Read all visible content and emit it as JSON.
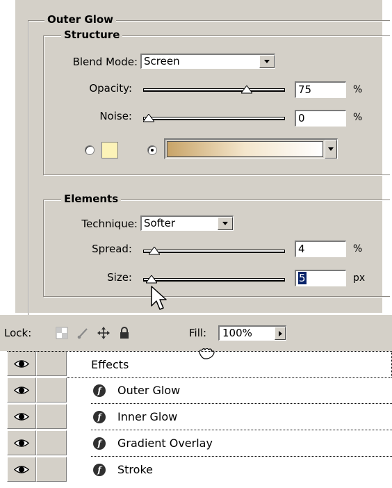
{
  "outer_glow": {
    "title": "Outer Glow",
    "structure": {
      "title": "Structure",
      "blend_mode_label": "Blend Mode:",
      "blend_mode_value": "Screen",
      "opacity_label": "Opacity:",
      "opacity_value": "75",
      "opacity_unit": "%",
      "opacity_level": 0.75,
      "noise_label": "Noise:",
      "noise_value": "0",
      "noise_unit": "%",
      "noise_level": 0.0,
      "solid_color": "#fcf3b8",
      "gradient_colors": [
        "#c8a468",
        "#f4e6cc",
        "#ffffff"
      ],
      "color_radio_selected": "gradient"
    },
    "elements": {
      "title": "Elements",
      "technique_label": "Technique:",
      "technique_value": "Softer",
      "spread_label": "Spread:",
      "spread_value": "4",
      "spread_unit": "%",
      "spread_level": 0.04,
      "size_label": "Size:",
      "size_value": "5",
      "size_unit": "px",
      "size_level": 0.02
    }
  },
  "layers_panel": {
    "lock_label": "Lock:",
    "lock_icons": [
      "lock-transparent-icon",
      "lock-brush-icon",
      "lock-move-icon",
      "lock-all-icon"
    ],
    "fill_label": "Fill:",
    "fill_value": "100%",
    "effects_label": "Effects",
    "effects": [
      {
        "name": "Outer Glow",
        "icon": "fx-icon",
        "visible": true
      },
      {
        "name": "Inner Glow",
        "icon": "fx-icon",
        "visible": true
      },
      {
        "name": "Gradient Overlay",
        "icon": "fx-icon",
        "visible": true
      },
      {
        "name": "Stroke",
        "icon": "fx-icon",
        "visible": true
      }
    ]
  }
}
